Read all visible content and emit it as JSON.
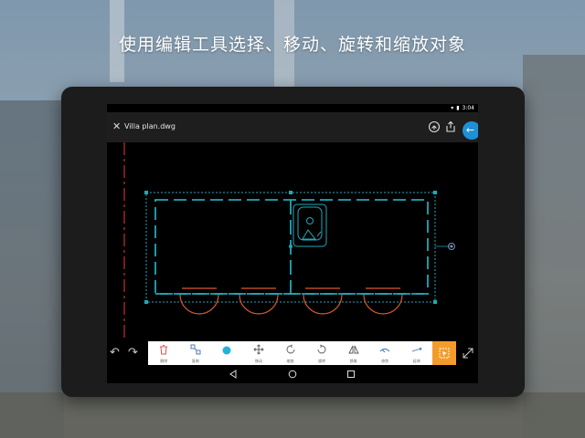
{
  "caption": "使用编辑工具选择、移动、旋转和缩放对象",
  "status_bar": {
    "time": "3:04"
  },
  "app_bar": {
    "file_name": "Villa plan.dwg",
    "close_icon": "close-icon",
    "share_icon": "share-icon",
    "export_icon": "export-icon",
    "back_icon": "arrow-left-icon"
  },
  "tools": [
    {
      "label": "删除",
      "icon": "trash-icon"
    },
    {
      "label": "复制",
      "icon": "copy-icon"
    },
    {
      "label": "",
      "icon": "color-dot-icon"
    },
    {
      "label": "移动",
      "icon": "move-icon"
    },
    {
      "label": "缩放",
      "icon": "scale-icon"
    },
    {
      "label": "旋转",
      "icon": "rotate-icon"
    },
    {
      "label": "镜像",
      "icon": "mirror-icon"
    },
    {
      "label": "修剪",
      "icon": "trim-icon"
    },
    {
      "label": "延伸",
      "icon": "extend-icon"
    }
  ],
  "colors": {
    "selection": "#1fa9b8",
    "red_axis": "#c8302c",
    "orange_arcs": "#d9592c",
    "accent_blue": "#1e90d8",
    "accent_orange": "#f39c2b"
  }
}
